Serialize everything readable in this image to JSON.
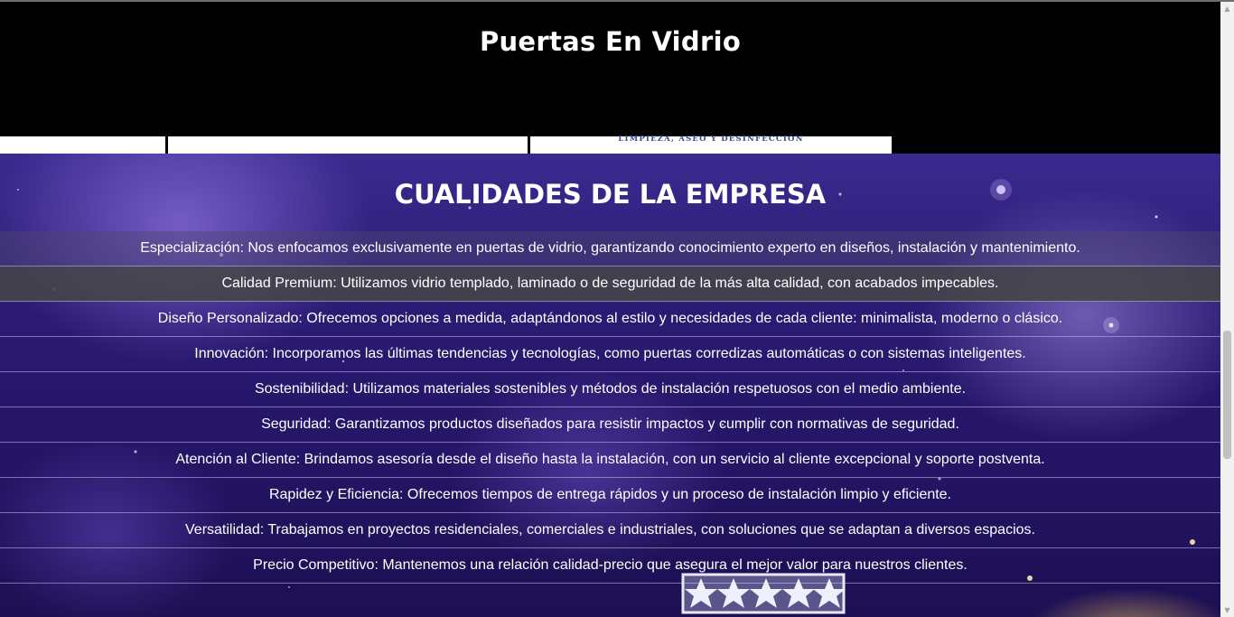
{
  "header": {
    "title": "Puertas En Vidrio"
  },
  "gallery": {
    "card3_caption": "LIMPIEZA, ASEO Y DESINFECCIÓN"
  },
  "qualities": {
    "title": "CUALIDADES DE LA EMPRESA",
    "items": [
      "Especialización: Nos enfocamos exclusivamente en puertas de vidrio, garantizando conocimiento experto en diseños, instalación y mantenimiento.",
      "Calidad Premium: Utilizamos vidrio templado, laminado o de seguridad de la más alta calidad, con acabados impecables.",
      "Diseño Personalizado: Ofrecemos opciones a medida, adaptándonos al estilo y necesidades de cada cliente: minimalista, moderno o clásico.",
      "Innovación: Incorporamos las últimas tendencias y tecnologías, como puertas corredizas automáticas o con sistemas inteligentes.",
      "Sostenibilidad: Utilizamos materiales sostenibles y métodos de instalación respetuosos con el medio ambiente.",
      "Seguridad: Garantizamos productos diseñados para resistir impactos y cumplir con normativas de seguridad.",
      "Atención al Cliente: Brindamos asesoría desde el diseño hasta la instalación, con un servicio al cliente excepcional y soporte postventa.",
      "Rapidez y Eficiencia: Ofrecemos tiempos de entrega rápidos y un proceso de instalación limpio y eficiente.",
      "Versatilidad: Trabajamos en proyectos residenciales, comerciales e industriales, con soluciones que se adaptan a diversos espacios.",
      "Precio Competitivo: Mantenemos una relación calidad-precio que asegura el mejor valor para nuestros clientes."
    ]
  },
  "icons": {
    "scroll_up": "scroll-up-arrow-icon",
    "scroll_down": "scroll-down-arrow-icon",
    "stars_badge": "five-star-rating-badge"
  },
  "colors": {
    "header_bg": "#000000",
    "section_bg": "#2a1a72",
    "highlight_row": "#464648",
    "text": "#ffffff"
  }
}
